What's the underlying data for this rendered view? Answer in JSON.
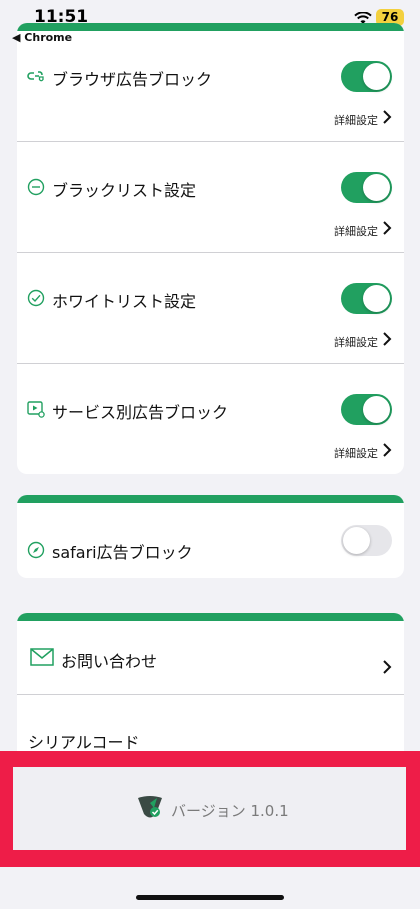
{
  "status_bar": {
    "time": "11:51",
    "back_label": "◀ Chrome",
    "battery": "76"
  },
  "block_settings": [
    {
      "title": "ブラウザ広告ブロック",
      "icon": "link-shield-icon",
      "enabled": true,
      "detail": "詳細設定"
    },
    {
      "title": "ブラックリスト設定",
      "icon": "minus-circle-icon",
      "enabled": true,
      "detail": "詳細設定"
    },
    {
      "title": "ホワイトリスト設定",
      "icon": "check-circle-icon",
      "enabled": true,
      "detail": "詳細設定"
    },
    {
      "title": "サービス別広告ブロック",
      "icon": "video-gear-icon",
      "enabled": true,
      "detail": "詳細設定"
    }
  ],
  "safari": {
    "title": "safari広告ブロック",
    "icon": "compass-icon",
    "enabled": false
  },
  "menu": {
    "contact": "お問い合わせ",
    "serial": "シリアルコード"
  },
  "footer": {
    "version": "バージョン 1.0.1"
  },
  "colors": {
    "accent": "#21a060",
    "highlight": "#ee1d48",
    "background": "#f2f2f6"
  }
}
